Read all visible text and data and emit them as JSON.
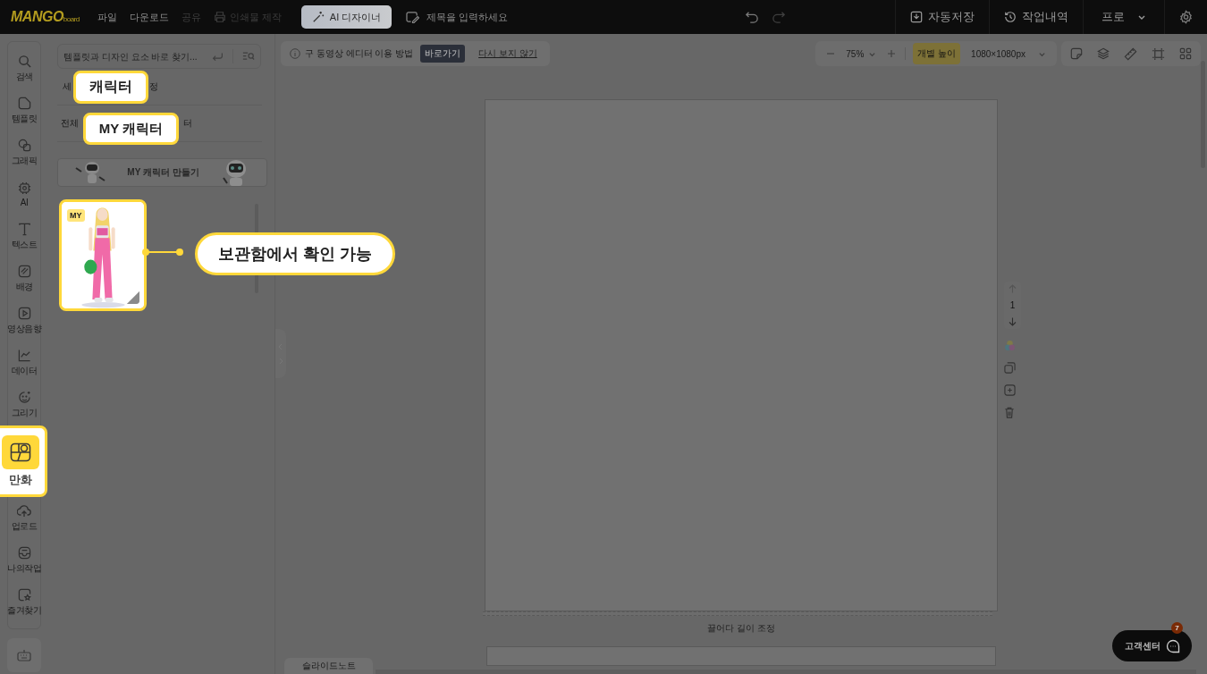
{
  "topbar": {
    "logo": "MANGO",
    "logo_sub": "board",
    "menu": [
      {
        "label": "파일",
        "disabled": false
      },
      {
        "label": "다운로드",
        "disabled": false
      },
      {
        "label": "공유",
        "disabled": true
      }
    ],
    "print": {
      "label": "인쇄물 제작",
      "disabled": true
    },
    "ai_button": "AI 디자이너",
    "title_placeholder": "제목을 입력하세요",
    "autosave": "자동저장",
    "history": "작업내역",
    "plan": "프로"
  },
  "rail": {
    "items": [
      {
        "label": "검색",
        "selected": false
      },
      {
        "label": "템플릿",
        "selected": false
      },
      {
        "label": "그래픽",
        "selected": false
      },
      {
        "label": "AI",
        "selected": false
      },
      {
        "label": "텍스트",
        "selected": false
      },
      {
        "label": "배경",
        "selected": false
      },
      {
        "label": "영상음향",
        "selected": false
      },
      {
        "label": "데이터",
        "selected": false
      },
      {
        "label": "그리기",
        "selected": false
      },
      {
        "label": "만화",
        "selected": true
      },
      {
        "label": "업로드",
        "selected": false
      },
      {
        "label": "나의작업",
        "selected": false
      },
      {
        "label": "즐겨찾기",
        "selected": false
      }
    ]
  },
  "panel": {
    "search_placeholder": "템플릿과 디자인 요소 바로 찾기...",
    "tab_row_1": [
      "세",
      "정"
    ],
    "tab_row_2": [
      "전체",
      "터"
    ],
    "banner": "MY 캐릭터 만들기",
    "cards": [
      {
        "kind": "picture",
        "badge": "MY"
      }
    ]
  },
  "callouts": {
    "tab": "캐릭터",
    "subtab": "MY 캐릭터",
    "card": "보관함에서 확인 가능"
  },
  "notice": {
    "text": "구 동영상 에디터 이용 방법",
    "button": "바로가기",
    "dismiss": "다시 보지 않기"
  },
  "zoom": {
    "value": "75%",
    "height_button": "개별 높이",
    "size": "1080×1080px"
  },
  "page_controls": {
    "page": "1"
  },
  "resize_hint": "끌어다 길이 조정",
  "notes_tab": "슬라이드노트",
  "support": {
    "label": "고객센터",
    "badge": "7"
  }
}
